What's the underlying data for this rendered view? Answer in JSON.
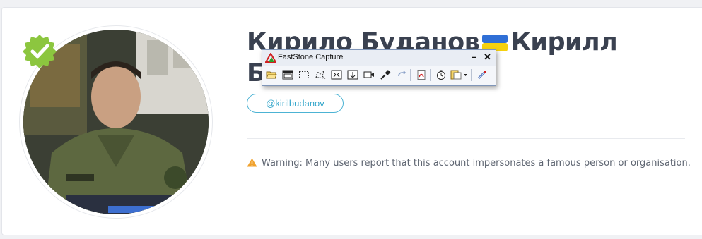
{
  "profile": {
    "name": "Кирило Буданов 🇺🇦 Кирилл Буданов",
    "name_line1": "Кирило Буданов",
    "name_after_flag": "Кирилл",
    "name_line2": "Б",
    "handle": "@kirilbudanov",
    "warning": "Warning: Many users report that this account impersonates a famous person or organisation.",
    "verified_color": "#8cc63f",
    "accent_color": "#36a7cb"
  },
  "faststone": {
    "title": "FastStone Capture",
    "minimize": "–",
    "close": "✕"
  },
  "icons": [
    "verified-badge-icon",
    "ukraine-flag-icon",
    "warning-icon",
    "faststone-logo-icon",
    "open-folder-icon",
    "capture-window-icon",
    "capture-rectangle-icon",
    "capture-freehand-icon",
    "capture-fullscreen-icon",
    "capture-scrolling-icon",
    "screen-recorder-icon",
    "color-picker-icon",
    "repeat-capture-icon",
    "pdf-icon",
    "timer-icon",
    "output-icon",
    "settings-icon"
  ]
}
